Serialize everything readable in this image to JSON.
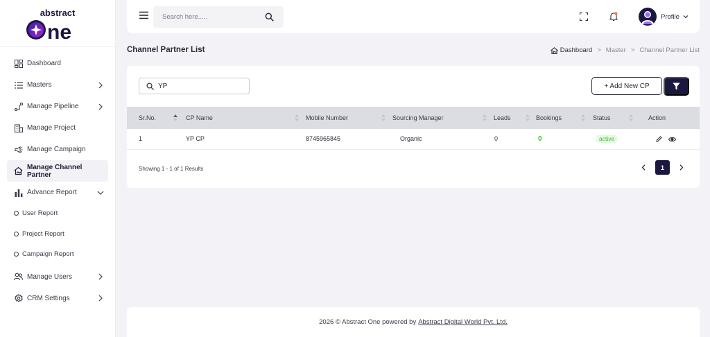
{
  "brand": {
    "line1": "abstract",
    "line2": "one"
  },
  "sidebar": {
    "items": [
      {
        "label": "Dashboard",
        "icon": "dashboard-icon",
        "chevron": false
      },
      {
        "label": "Masters",
        "icon": "list-icon",
        "chevron": true
      },
      {
        "label": "Manage Pipeline",
        "icon": "pipeline-icon",
        "chevron": true
      },
      {
        "label": "Manage Project",
        "icon": "building-icon",
        "chevron": false
      },
      {
        "label": "Manage Campaign",
        "icon": "megaphone-icon",
        "chevron": false
      },
      {
        "label": "Manage Channel Partner",
        "icon": "handshake-icon",
        "chevron": false,
        "active": true
      },
      {
        "label": "Advance Report",
        "icon": "bar-chart-icon",
        "chevron": true,
        "expanded": true
      }
    ],
    "sub_items": [
      "User Report",
      "Project Report",
      "Campaign Report"
    ],
    "bottom_items": [
      {
        "label": "Manage Users",
        "icon": "users-icon",
        "chevron": true
      },
      {
        "label": "CRM Settings",
        "icon": "gear-icon",
        "chevron": true
      }
    ]
  },
  "header": {
    "search_placeholder": "Search here.....",
    "profile_label": "Profile"
  },
  "page": {
    "title": "Channel Partner List",
    "breadcrumb": [
      "Dashboard",
      "Master",
      "Channel Partner List"
    ]
  },
  "toolbar": {
    "search_value": "YP",
    "add_button": "+ Add New CP"
  },
  "table": {
    "columns": [
      "Sr.No.",
      "CP Name",
      "Mobile Number",
      "Sourcing Manager",
      "Leads",
      "Bookings",
      "Status",
      "Action"
    ],
    "rows": [
      {
        "sr": "1",
        "name": "YP CP",
        "mobile": "8745965845",
        "manager": "Organic",
        "leads": "0",
        "bookings": "0",
        "status": "active"
      }
    ]
  },
  "pagination": {
    "summary": "Showing 1 - 1 of 1 Results",
    "current_page": "1"
  },
  "footer": {
    "text": "2026 © Abstract One powered by",
    "link": "Abstract Digital World Pvt. Ltd."
  },
  "colors": {
    "brand_dark": "#1b1840",
    "brand_purple": "#7b2ff7",
    "status_green": "#3cbf2f",
    "notification_orange": "#f07a3a"
  }
}
